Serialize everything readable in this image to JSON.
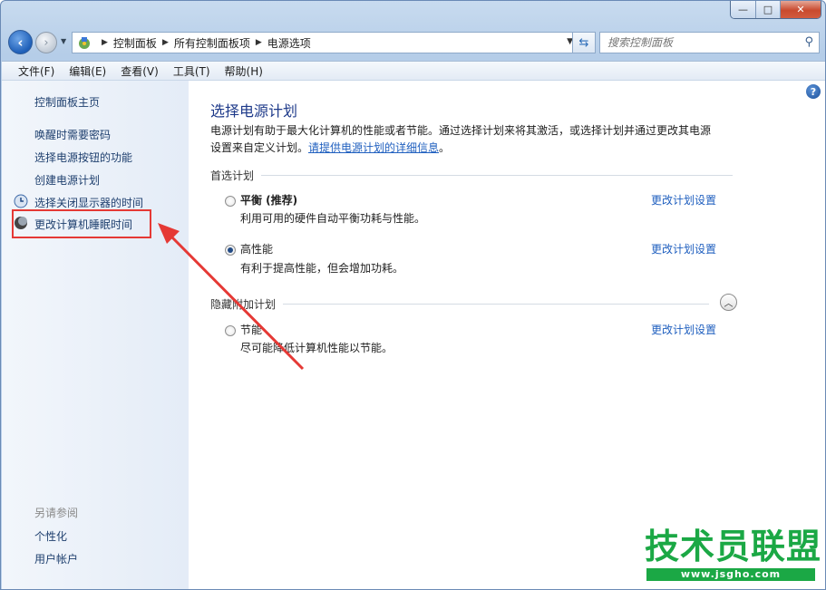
{
  "window": {
    "caption": {
      "min": "—",
      "max": "□",
      "close": "✕"
    }
  },
  "nav": {
    "breadcrumb": [
      "控制面板",
      "所有控制面板项",
      "电源选项"
    ],
    "search_placeholder": "搜索控制面板"
  },
  "menu": [
    "文件(F)",
    "编辑(E)",
    "查看(V)",
    "工具(T)",
    "帮助(H)"
  ],
  "sidebar": {
    "home": "控制面板主页",
    "links": [
      "唤醒时需要密码",
      "选择电源按钮的功能",
      "创建电源计划",
      "选择关闭显示器的时间",
      "更改计算机睡眠时间"
    ],
    "see_also_title": "另请参阅",
    "see_also": [
      "个性化",
      "用户帐户"
    ]
  },
  "main": {
    "title": "选择电源计划",
    "description": "电源计划有助于最大化计算机的性能或者节能。通过选择计划来将其激活，或选择计划并通过更改其电源设置来自定义计划。",
    "details_link": "请提供电源计划的详细信息",
    "preferred_group": "首选计划",
    "hidden_group": "隐藏附加计划",
    "plans": [
      {
        "name": "平衡 (推荐)",
        "desc": "利用可用的硬件自动平衡功耗与性能。",
        "selected": false,
        "change": "更改计划设置"
      },
      {
        "name": "高性能",
        "desc": "有利于提高性能，但会增加功耗。",
        "selected": true,
        "change": "更改计划设置"
      },
      {
        "name": "节能",
        "desc": "尽可能降低计算机性能以节能。",
        "selected": false,
        "change": "更改计划设置"
      }
    ]
  },
  "watermark": {
    "title": "技术员联盟",
    "url": "www.jsgho.com"
  },
  "colors": {
    "link": "#1f5fbf",
    "heading": "#1e3a8a",
    "annotation": "#e53935",
    "watermark": "#1ba845"
  }
}
